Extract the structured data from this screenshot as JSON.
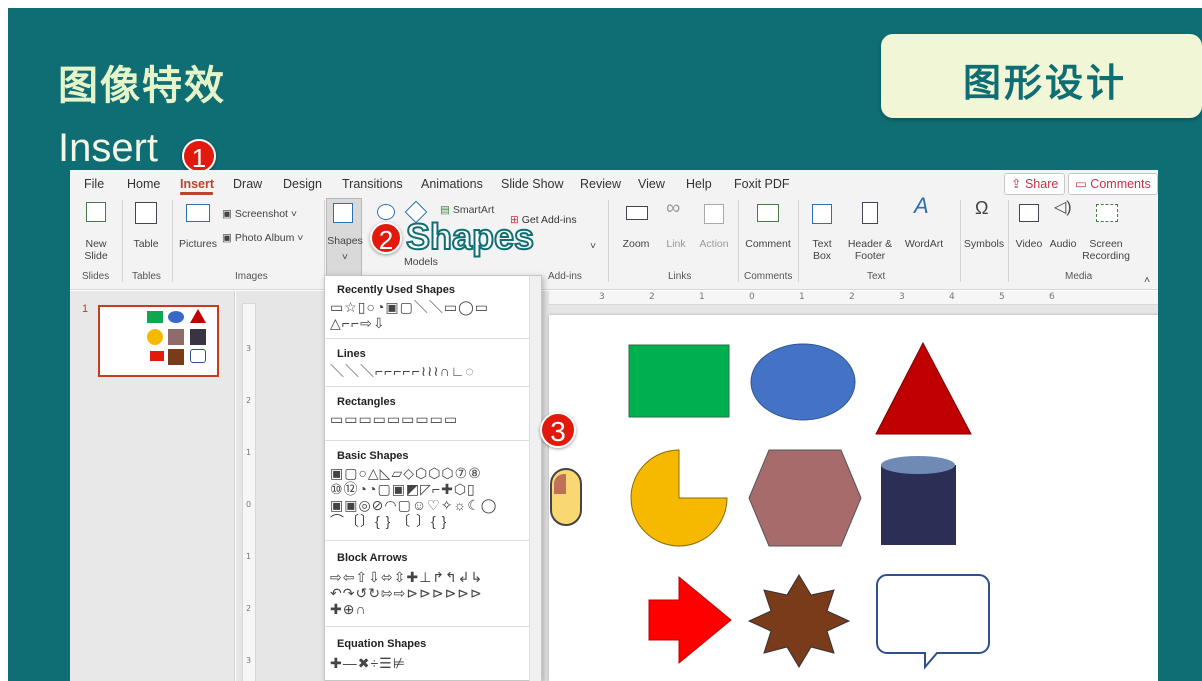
{
  "slide_title": "图像特效",
  "tag": "图形设计",
  "subtitle": "Insert",
  "steps": [
    "1",
    "2",
    "3"
  ],
  "step2_label": "Shapes",
  "menu": [
    "File",
    "Home",
    "Insert",
    "Draw",
    "Design",
    "Transitions",
    "Animations",
    "Slide Show",
    "Review",
    "View",
    "Help",
    "Foxit PDF"
  ],
  "share": "Share",
  "comments": "Comments",
  "ribbon": {
    "new_slide": "New Slide",
    "table": "Table",
    "pictures": "Pictures",
    "screenshot": "Screenshot",
    "photo_album": "Photo Album",
    "shapes": "Shapes",
    "models": "Models",
    "smartart": "SmartArt",
    "get_addins": "Get Add-ins",
    "zoom": "Zoom",
    "link": "Link",
    "action": "Action",
    "comment": "Comment",
    "text_box": "Text Box",
    "header_footer": "Header & Footer",
    "wordart": "WordArt",
    "symbols": "Symbols",
    "video": "Video",
    "audio": "Audio",
    "screen_recording": "Screen Recording"
  },
  "groups": [
    "Slides",
    "Tables",
    "Images",
    "Add-ins",
    "Links",
    "Comments",
    "Text",
    "Media"
  ],
  "slide_number": "1",
  "dropdown": {
    "sections": [
      "Recently Used Shapes",
      "Lines",
      "Rectangles",
      "Basic Shapes",
      "Block Arrows",
      "Equation Shapes"
    ],
    "recent_row1": "▭☆▯○◔▣▢＼＼▭◯▭",
    "recent_row2": "△⌐⌐⇨⇩",
    "lines": "＼＼＼⌐⌐⌐⌐⌐≀≀≀∩∟◌",
    "rects": "▭▭▭▭▭▭▭▭▭",
    "basic1": "▣▢○△◺▱◇⬡⬡⬡⑦⑧",
    "basic2": "⑩⑫◔◔▢▣◩◸⌐✚⬡▯",
    "basic3": "▣▣◎⊘◠▢☺♡✧☼☾◯",
    "basic4": "⌒〔〕{ } 〔 〕{ }",
    "arrows1": "⇨⇦⇧⇩⬄⇳✚⊥↱↰↲↳",
    "arrows2": "↶↷↺↻⇰⇨⊳⊳⊳⊳⊳⊳",
    "arrows3": "✚⊕∩",
    "equations": "✚—✖÷☰⊭"
  },
  "ruler": {
    "h": [
      "3",
      "2",
      "1",
      "0",
      "1",
      "2",
      "3",
      "4",
      "5",
      "6"
    ],
    "v": [
      "3",
      "2",
      "1",
      "0",
      "1",
      "2",
      "3"
    ]
  },
  "colors": {
    "teal": "#0f6e74",
    "red_badge": "#e11a0d",
    "accent": "#b7472a"
  }
}
